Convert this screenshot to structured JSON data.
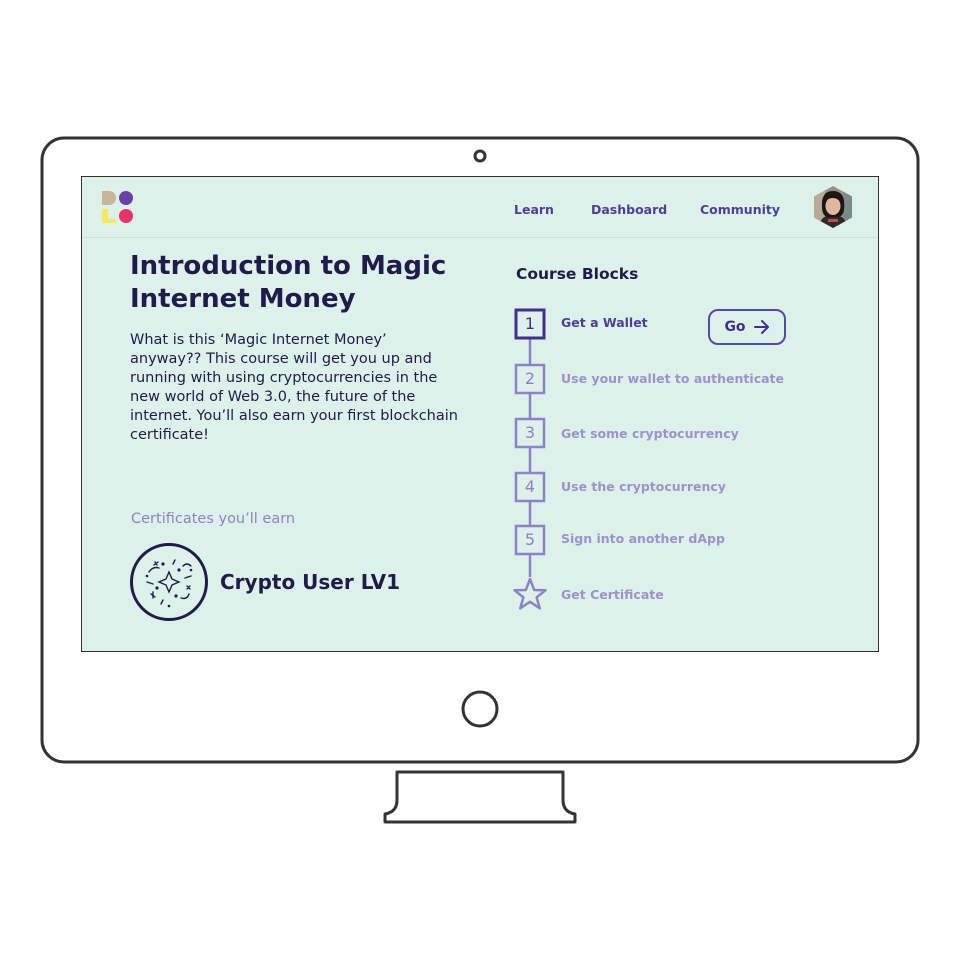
{
  "nav": {
    "links": [
      "Learn",
      "Dashboard",
      "Community"
    ]
  },
  "course": {
    "title": "Introduction to Magic Internet Money",
    "description": "What is this ‘Magic Internet Money’ anyway?? This course will get you up and running with using cryptocurrencies in the new world of Web 3.0, the future of the internet. You’ll also earn your first blockchain certificate!",
    "certificates_heading": "Certificates you’ll earn",
    "certificate_name": "Crypto User LV1"
  },
  "blocks": {
    "heading": "Course Blocks",
    "go_label": "Go",
    "steps": [
      {
        "number": "1",
        "label": "Get a Wallet"
      },
      {
        "number": "2",
        "label": "Use your wallet to authenticate"
      },
      {
        "number": "3",
        "label": "Get some cryptocurrency"
      },
      {
        "number": "4",
        "label": "Use the cryptocurrency"
      },
      {
        "number": "5",
        "label": "Sign into another dApp"
      }
    ],
    "final_label": "Get Certificate",
    "active_step": 1
  },
  "colors": {
    "screen_bg": "#ddf1eb",
    "primary": "#4d3e9a",
    "muted": "#8d82c8",
    "text": "#1f1b4a",
    "frame": "#333333"
  },
  "icons": {
    "logo": "dolo-logo",
    "avatar": "user-avatar",
    "badge": "certificate-badge-icon",
    "arrow": "arrow-right-icon",
    "final": "star-icon"
  }
}
